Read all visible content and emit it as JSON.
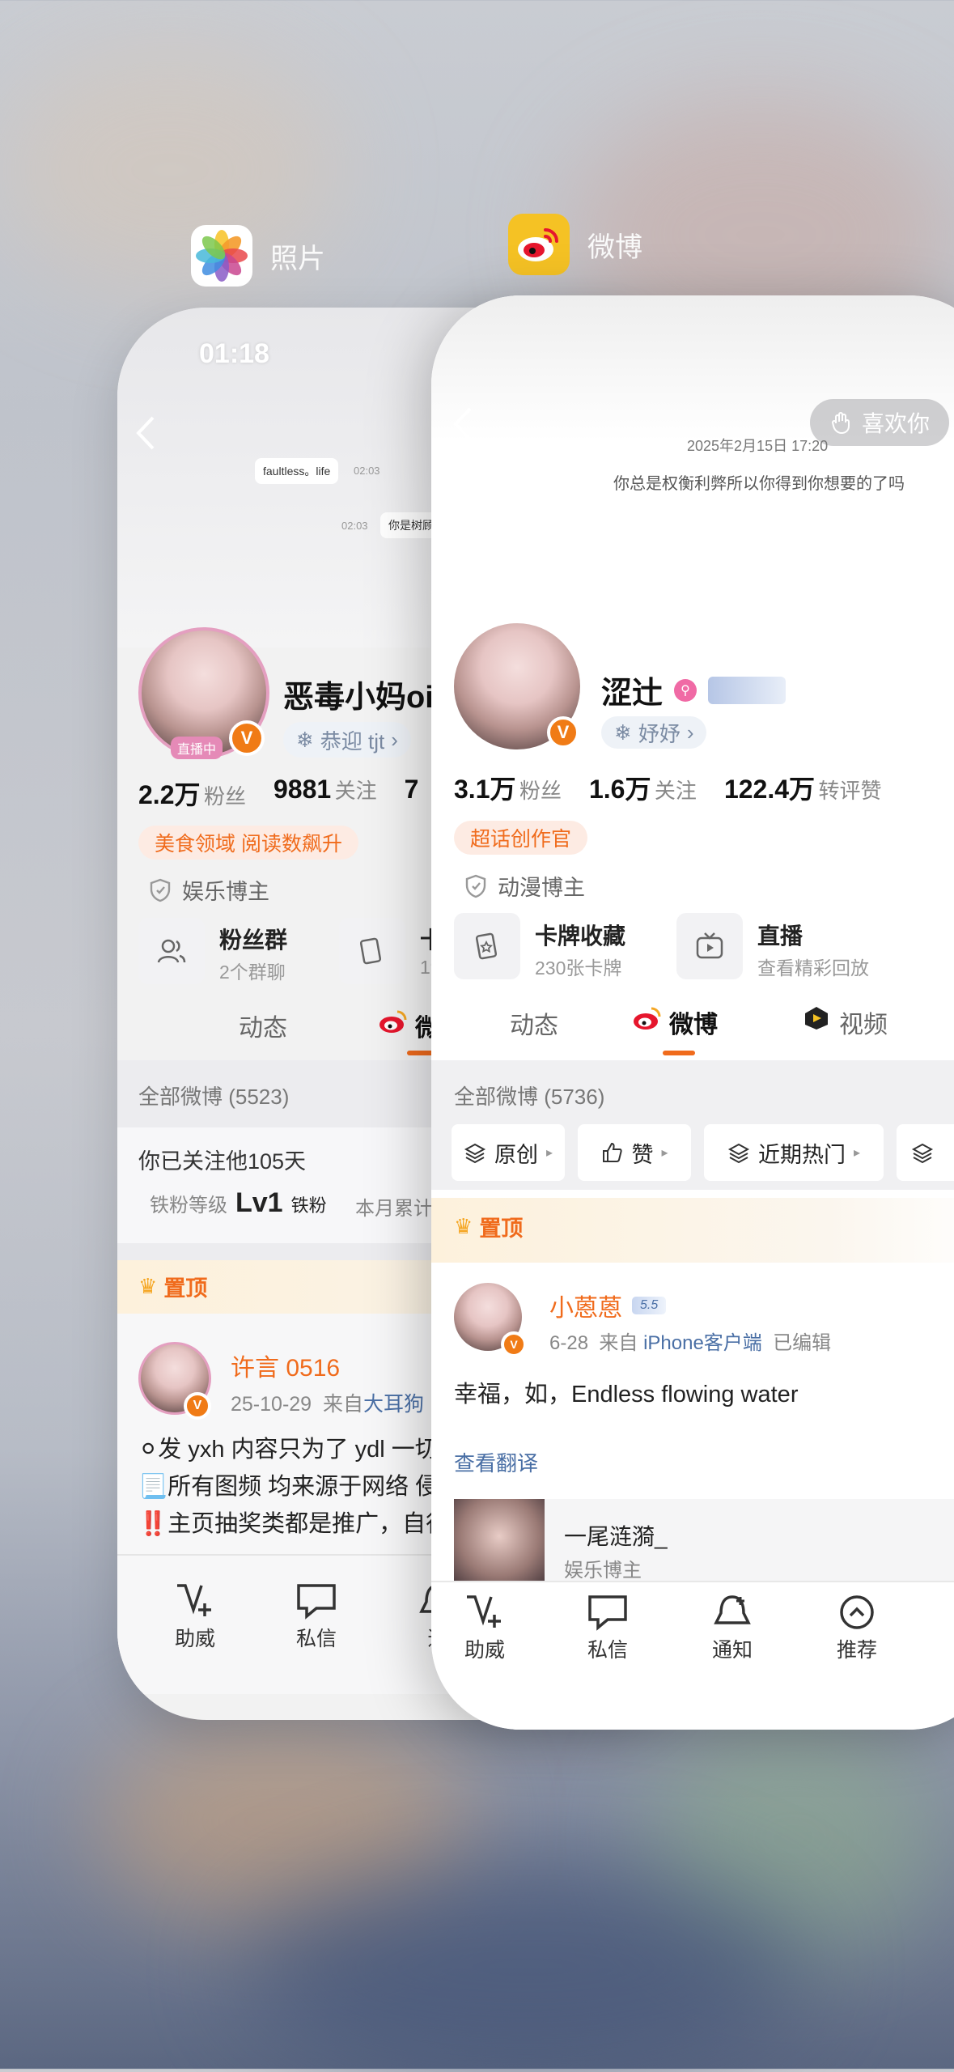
{
  "switcher": {
    "photos_app": {
      "name": "照片"
    },
    "weibo_app": {
      "name": "微博"
    }
  },
  "photos_card": {
    "time": "01:18",
    "chat": {
      "bubble1": "faultless。life",
      "time1": "02:03",
      "time2": "02:03",
      "bubble2": "你是树顾"
    },
    "profile": {
      "name": "恶毒小妈oi",
      "greeting": "恭迎 tjt",
      "live_tag": "直播中",
      "stats": [
        {
          "num": "2.2万",
          "label": "粉丝"
        },
        {
          "num": "9881",
          "label": "关注"
        },
        {
          "num": "7",
          "label": ""
        }
      ],
      "domain_tag": "美食领域 阅读数飙升",
      "role": "娱乐博主",
      "tiles": [
        {
          "title": "粉丝群",
          "sub": "2个群聊"
        },
        {
          "title": "卡",
          "sub": "19"
        }
      ]
    },
    "tabs": [
      "动态",
      "微"
    ],
    "all_weibo": "全部微博 (5523)",
    "follow_days": "你已关注他105天",
    "fan_level_label": "铁粉等级",
    "fan_level_value": "Lv1",
    "fan_level_suffix": "铁粉",
    "month_label": "本月累计",
    "pinned": "置顶",
    "post": {
      "author": "许言 0516",
      "date": "25-10-29",
      "source_prefix": "来自",
      "source": "大耳狗",
      "lines": [
        "⚪发 yxh 内容只为了 ydl 一切",
        "📃所有图频 均来源于网络 侵",
        "‼️主页抽奖类都是推广，自行"
      ]
    },
    "bottom_nav": [
      "助威",
      "私信",
      "通"
    ]
  },
  "weibo_card": {
    "like_you": "喜欢你",
    "cover_date": "2025年2月15日 17:20",
    "cover_text": "你总是权衡利弊所以你得到你想要的了吗",
    "profile": {
      "name": "涩辻",
      "greeting": "妤妤",
      "stats": [
        {
          "num": "3.1万",
          "label": "粉丝"
        },
        {
          "num": "1.6万",
          "label": "关注"
        },
        {
          "num": "122.4万",
          "label": "转评赞"
        }
      ],
      "badge": "超话创作官",
      "role": "动漫博主",
      "tiles": [
        {
          "title": "卡牌收藏",
          "sub": "230张卡牌"
        },
        {
          "title": "直播",
          "sub": "查看精彩回放"
        }
      ]
    },
    "tabs": [
      "动态",
      "微博",
      "视频"
    ],
    "all_weibo": "全部微博 (5736)",
    "filters": [
      "原创",
      "赞",
      "近期热门"
    ],
    "pinned": "置顶",
    "post": {
      "author": "小蒽蒽",
      "level": "5.5",
      "date": "6-28",
      "source_prefix": "来自",
      "source": "iPhone客户端",
      "edited": "已编辑",
      "text": "幸福，如，Endless flowing water",
      "translate": "查看翻译",
      "repost_name": "一尾涟漪_",
      "repost_role": "娱乐博主"
    },
    "bottom_nav": [
      "助威",
      "私信",
      "通知",
      "推荐"
    ]
  },
  "colors": {
    "accent": "#f06b1c",
    "link": "#4a6fa5",
    "weibo_red": "#e6162d"
  }
}
